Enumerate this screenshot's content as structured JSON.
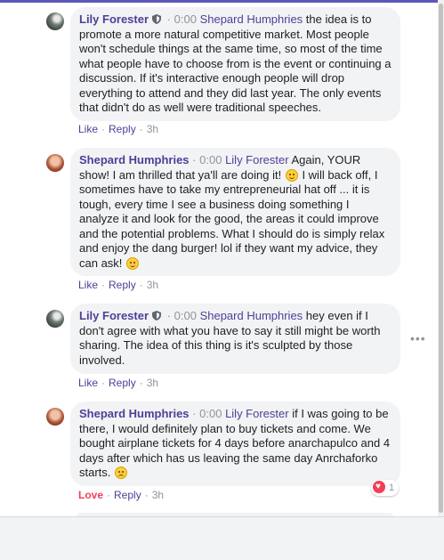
{
  "comments": [
    {
      "author": "Lily Forester",
      "time": "0:00",
      "mention": "Shepard Humphries",
      "segments": [
        " the idea is to promote a more natural competitive market. Most people won't schedule things at the same time, so most of the time what people have to choose from is the event or continuing a discussion. If it's interactive enough people will drop everything to attend and they did last year. The only events that didn't do as well were traditional speeches."
      ],
      "like": "Like",
      "reply": "Reply",
      "age": "3h"
    },
    {
      "author": "Shepard Humphries",
      "time": "0:00",
      "mention": "Lily Forester",
      "segments": [
        " Again, YOUR show! I am thrilled that ya'll are doing it! ",
        " I will back off, I sometimes have to take my entrepreneurial hat off ... it is tough, every time I see a business doing something I analyze it and look for the good, the areas it could improve and the potential problems. What I should do is simply relax and enjoy the dang burger! lol if they want my advice, they can ask! "
      ],
      "like": "Like",
      "reply": "Reply",
      "age": "3h"
    },
    {
      "author": "Lily Forester",
      "time": "0:00",
      "mention": "Shepard Humphries",
      "segments": [
        " hey even if I don't agree with what you have to say it still might be worth sharing. The idea of this thing is it's sculpted by those involved."
      ],
      "like": "Like",
      "reply": "Reply",
      "age": "3h"
    },
    {
      "author": "Shepard Humphries",
      "time": "0:00",
      "mention": "Lily Forester",
      "segments": [
        " if I was going to be there, I would definitely plan to buy tickets and come. We bought airplane tickets for 4 days before anarchapulco and 4 days after which has us leaving the same day Anrchaforko starts. "
      ],
      "like": "Love",
      "reply": "Reply",
      "age": "3h",
      "reaction_count": "1"
    }
  ],
  "icons": {
    "more": "more-options-icon",
    "reaction": "heart-icon",
    "admin": "shield-icon"
  },
  "colors": {
    "accent": "#4e3f96",
    "love": "#f33e58",
    "bubble": "#f2f3f5",
    "muted": "#90949c"
  }
}
